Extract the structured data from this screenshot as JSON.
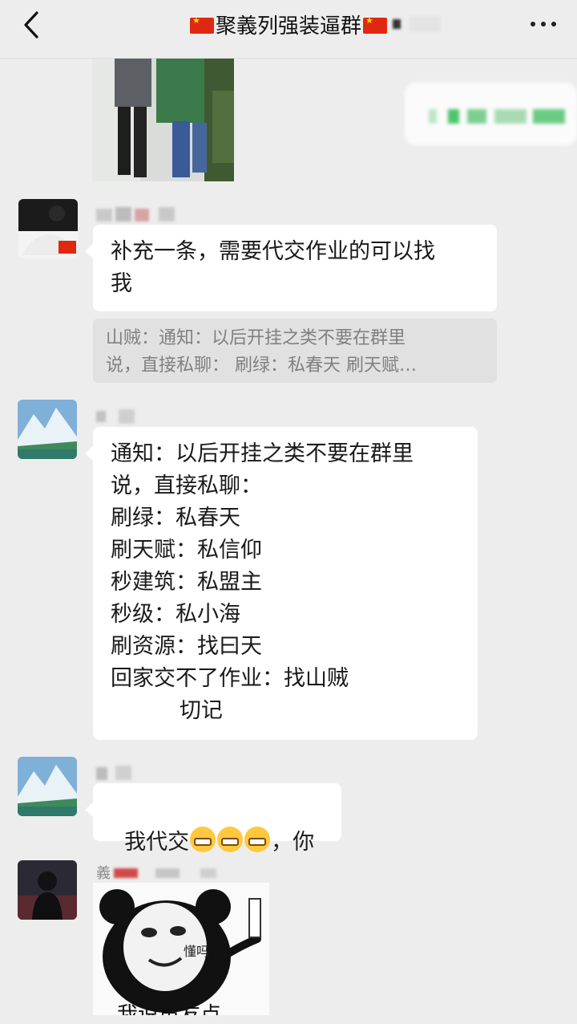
{
  "header": {
    "title": "聚義列强装逼群",
    "back_icon": "chevron-left-icon",
    "more_icon": "more-horizontal-icon"
  },
  "messages": [
    {
      "type": "image",
      "sender": "other",
      "description_icon": "photo-thumbnail"
    },
    {
      "type": "text",
      "sender": "other",
      "text": "补充一条，需要代交作业的可以找\n我",
      "quote": "山贼：通知：以后开挂之类不要在群里\n说，直接私聊： 刷绿：私春天 刷天赋…"
    },
    {
      "type": "text",
      "sender": "other",
      "text": "通知：以后开挂之类不要在群里\n说，直接私聊：\n刷绿：私春天\n刷天赋：私信仰\n秒建筑：私盟主\n秒级：私小海\n刷资源：找曰天\n回家交不了作业：找山贼\n          切记"
    },
    {
      "type": "text",
      "sender": "other",
      "text_before": "我代交",
      "text_after": "，你"
    },
    {
      "type": "sticker",
      "sender": "other",
      "name_prefix": "義",
      "sticker_text": "懂吗",
      "caption": "我说声友点"
    }
  ]
}
